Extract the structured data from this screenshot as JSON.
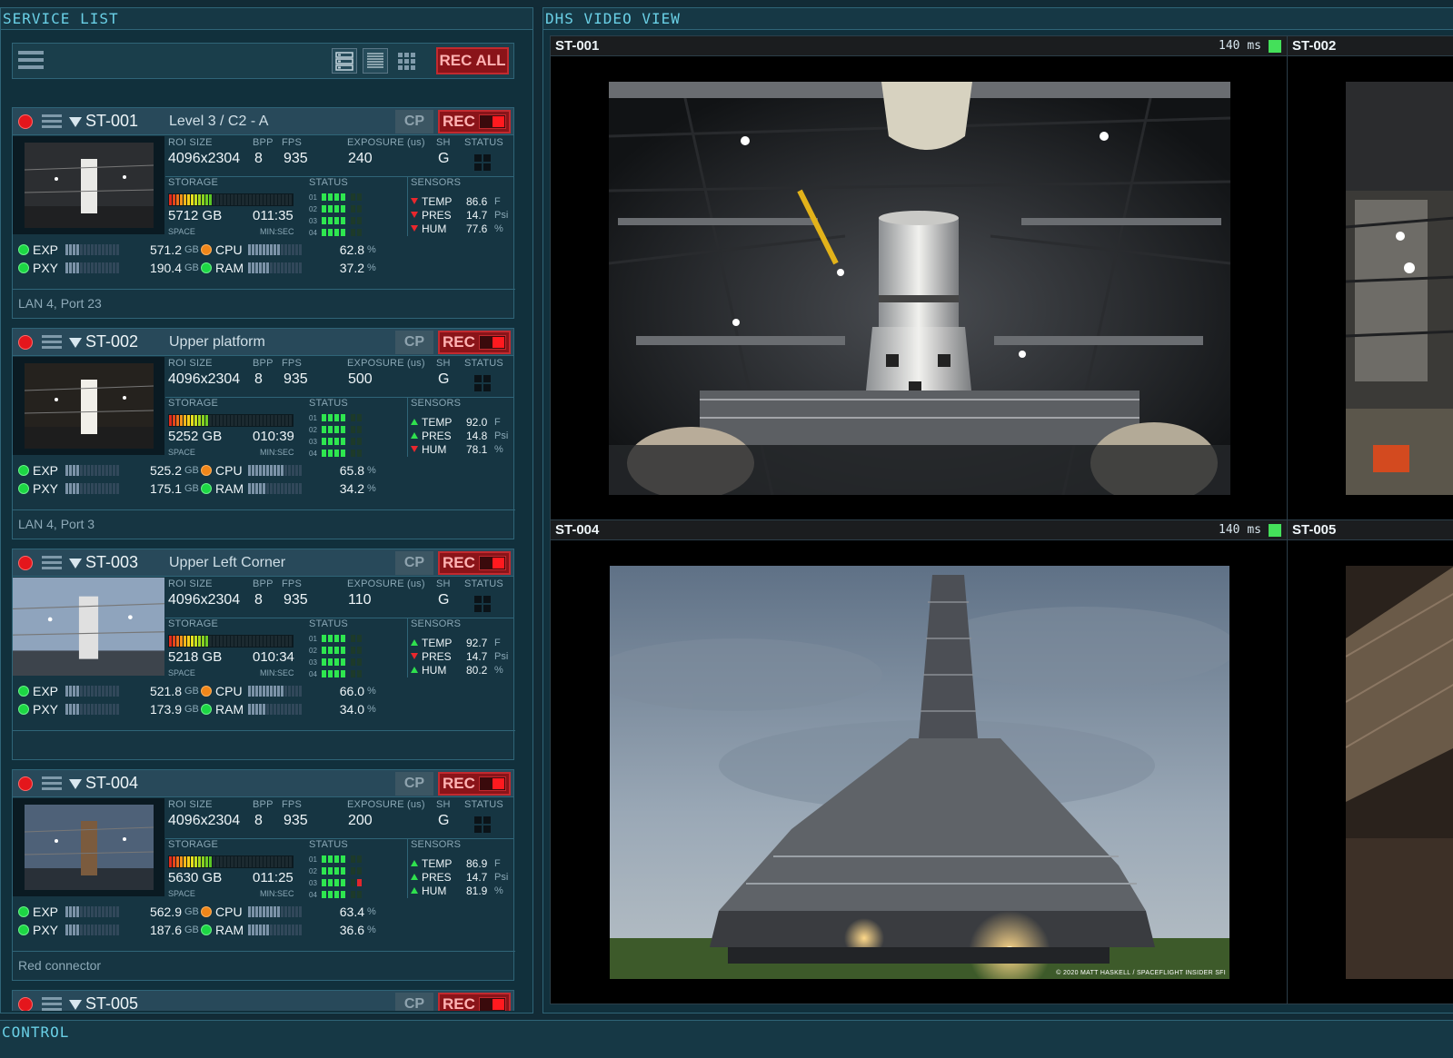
{
  "service_panel": {
    "title": "SERVICE LIST",
    "rec_all_label": "REC ALL"
  },
  "video_panel": {
    "title": "DHS VIDEO VIEW"
  },
  "control_panel": {
    "title": "CONTROL"
  },
  "labels": {
    "roi_size": "ROI SIZE",
    "bpp": "BPP",
    "fps": "FPS",
    "exposure": "EXPOSURE (us)",
    "sh": "SH",
    "status": "STATUS",
    "storage": "STORAGE",
    "sensors": "SENSORS",
    "space": "SPACE",
    "minsec": "MIN:SEC",
    "cp": "CP",
    "rec": "REC"
  },
  "services": [
    {
      "id": "ST-001",
      "name": "Level 3 / C2 - A",
      "roi": "4096x2304",
      "bpp": "8",
      "fps": "935",
      "exposure": "240",
      "sh": "G",
      "storage_fill": 0.35,
      "storage_space": "5712 GB",
      "storage_time": "011:35",
      "status_rows": [
        {
          "n": "01",
          "lit": 4
        },
        {
          "n": "02",
          "lit": 4
        },
        {
          "n": "03",
          "lit": 4
        },
        {
          "n": "04",
          "lit": 4
        }
      ],
      "sensors": [
        {
          "name": "TEMP",
          "value": "86.6",
          "unit": "F",
          "trend": "down"
        },
        {
          "name": "PRES",
          "value": "14.7",
          "unit": "Psi",
          "trend": "down"
        },
        {
          "name": "HUM",
          "value": "77.6",
          "unit": "%",
          "trend": "down"
        }
      ],
      "exp": {
        "label": "EXP",
        "value": "571.2",
        "unit": "GB",
        "fill": 0.25
      },
      "pxy": {
        "label": "PXY",
        "value": "190.4",
        "unit": "GB",
        "fill": 0.25
      },
      "cpu": {
        "label": "CPU",
        "value": "62.8",
        "unit": "%",
        "fill": 0.62
      },
      "ram": {
        "label": "RAM",
        "value": "37.2",
        "unit": "%",
        "fill": 0.37
      },
      "footer": "LAN 4, Port 23"
    },
    {
      "id": "ST-002",
      "name": "Upper platform",
      "roi": "4096x2304",
      "bpp": "8",
      "fps": "935",
      "exposure": "500",
      "sh": "G",
      "storage_fill": 0.32,
      "storage_space": "5252 GB",
      "storage_time": "010:39",
      "status_rows": [
        {
          "n": "01",
          "lit": 4
        },
        {
          "n": "02",
          "lit": 4
        },
        {
          "n": "03",
          "lit": 4
        },
        {
          "n": "04",
          "lit": 4
        }
      ],
      "sensors": [
        {
          "name": "TEMP",
          "value": "92.0",
          "unit": "F",
          "trend": "up"
        },
        {
          "name": "PRES",
          "value": "14.8",
          "unit": "Psi",
          "trend": "up"
        },
        {
          "name": "HUM",
          "value": "78.1",
          "unit": "%",
          "trend": "down"
        }
      ],
      "exp": {
        "label": "EXP",
        "value": "525.2",
        "unit": "GB",
        "fill": 0.25
      },
      "pxy": {
        "label": "PXY",
        "value": "175.1",
        "unit": "GB",
        "fill": 0.25
      },
      "cpu": {
        "label": "CPU",
        "value": "65.8",
        "unit": "%",
        "fill": 0.66
      },
      "ram": {
        "label": "RAM",
        "value": "34.2",
        "unit": "%",
        "fill": 0.34
      },
      "footer": "LAN 4, Port 3"
    },
    {
      "id": "ST-003",
      "name": "Upper Left Corner",
      "roi": "4096x2304",
      "bpp": "8",
      "fps": "935",
      "exposure": "110",
      "sh": "G",
      "storage_fill": 0.32,
      "storage_space": "5218 GB",
      "storage_time": "010:34",
      "status_rows": [
        {
          "n": "01",
          "lit": 4
        },
        {
          "n": "02",
          "lit": 4
        },
        {
          "n": "03",
          "lit": 4
        },
        {
          "n": "04",
          "lit": 4
        }
      ],
      "sensors": [
        {
          "name": "TEMP",
          "value": "92.7",
          "unit": "F",
          "trend": "up"
        },
        {
          "name": "PRES",
          "value": "14.7",
          "unit": "Psi",
          "trend": "down"
        },
        {
          "name": "HUM",
          "value": "80.2",
          "unit": "%",
          "trend": "up"
        }
      ],
      "exp": {
        "label": "EXP",
        "value": "521.8",
        "unit": "GB",
        "fill": 0.25
      },
      "pxy": {
        "label": "PXY",
        "value": "173.9",
        "unit": "GB",
        "fill": 0.25
      },
      "cpu": {
        "label": "CPU",
        "value": "66.0",
        "unit": "%",
        "fill": 0.66
      },
      "ram": {
        "label": "RAM",
        "value": "34.0",
        "unit": "%",
        "fill": 0.34
      },
      "footer": ""
    },
    {
      "id": "ST-004",
      "name": "",
      "roi": "4096x2304",
      "bpp": "8",
      "fps": "935",
      "exposure": "200",
      "sh": "G",
      "storage_fill": 0.35,
      "storage_space": "5630 GB",
      "storage_time": "011:25",
      "status_rows": [
        {
          "n": "01",
          "lit": 4
        },
        {
          "n": "02",
          "lit": 4
        },
        {
          "n": "03",
          "lit": 4,
          "alert": true
        },
        {
          "n": "04",
          "lit": 4
        }
      ],
      "sensors": [
        {
          "name": "TEMP",
          "value": "86.9",
          "unit": "F",
          "trend": "up"
        },
        {
          "name": "PRES",
          "value": "14.7",
          "unit": "Psi",
          "trend": "up"
        },
        {
          "name": "HUM",
          "value": "81.9",
          "unit": "%",
          "trend": "up"
        }
      ],
      "exp": {
        "label": "EXP",
        "value": "562.9",
        "unit": "GB",
        "fill": 0.25
      },
      "pxy": {
        "label": "PXY",
        "value": "187.6",
        "unit": "GB",
        "fill": 0.25
      },
      "cpu": {
        "label": "CPU",
        "value": "63.4",
        "unit": "%",
        "fill": 0.63
      },
      "ram": {
        "label": "RAM",
        "value": "36.6",
        "unit": "%",
        "fill": 0.37
      },
      "footer": "Red connector"
    },
    {
      "id": "ST-005",
      "name": ""
    }
  ],
  "video_tiles": [
    {
      "id": "ST-001",
      "latency": "140 ms"
    },
    {
      "id": "ST-002",
      "latency": ""
    },
    {
      "id": "ST-004",
      "latency": "140 ms",
      "credit": "© 2020 MATT HASKELL / SPACEFLIGHT INSIDER SFI"
    },
    {
      "id": "ST-005",
      "latency": ""
    }
  ],
  "colors": {
    "accent": "#6ad0e6",
    "rec_red": "#e4161c",
    "ok_green": "#1dd744",
    "warn_orange": "#f0861a"
  }
}
